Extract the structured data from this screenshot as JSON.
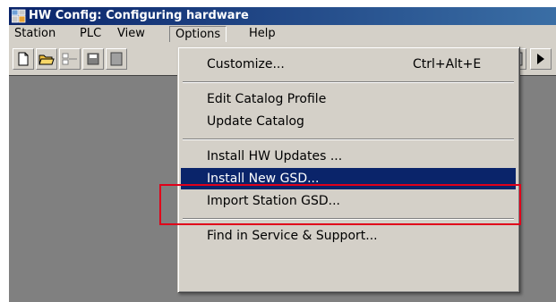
{
  "window": {
    "title": "HW Config: Configuring hardware"
  },
  "menubar": {
    "items": [
      "Station",
      "PLC",
      "View",
      "Options",
      "Help"
    ],
    "open_menu": "Options"
  },
  "options_menu": {
    "customize": {
      "label": "Customize...",
      "shortcut": "Ctrl+Alt+E"
    },
    "edit_catalog_profile": {
      "label": "Edit Catalog Profile"
    },
    "update_catalog": {
      "label": "Update Catalog"
    },
    "install_hw_updates": {
      "label": "Install HW Updates ..."
    },
    "install_new_gsd": {
      "label": "Install New GSD..."
    },
    "import_station_gsd": {
      "label": "Import Station GSD..."
    },
    "find_in_service_support": {
      "label": "Find in Service & Support..."
    }
  },
  "colors": {
    "selection": "#0a246a",
    "highlight_annotation": "#e0001a",
    "workspace": "#808080",
    "chrome": "#d4d0c8"
  },
  "icons": {
    "toolbar": [
      "new-file-icon",
      "open-folder-icon",
      "network-icon",
      "save-icon",
      "download-icon",
      "module-icon",
      "play-icon"
    ]
  }
}
